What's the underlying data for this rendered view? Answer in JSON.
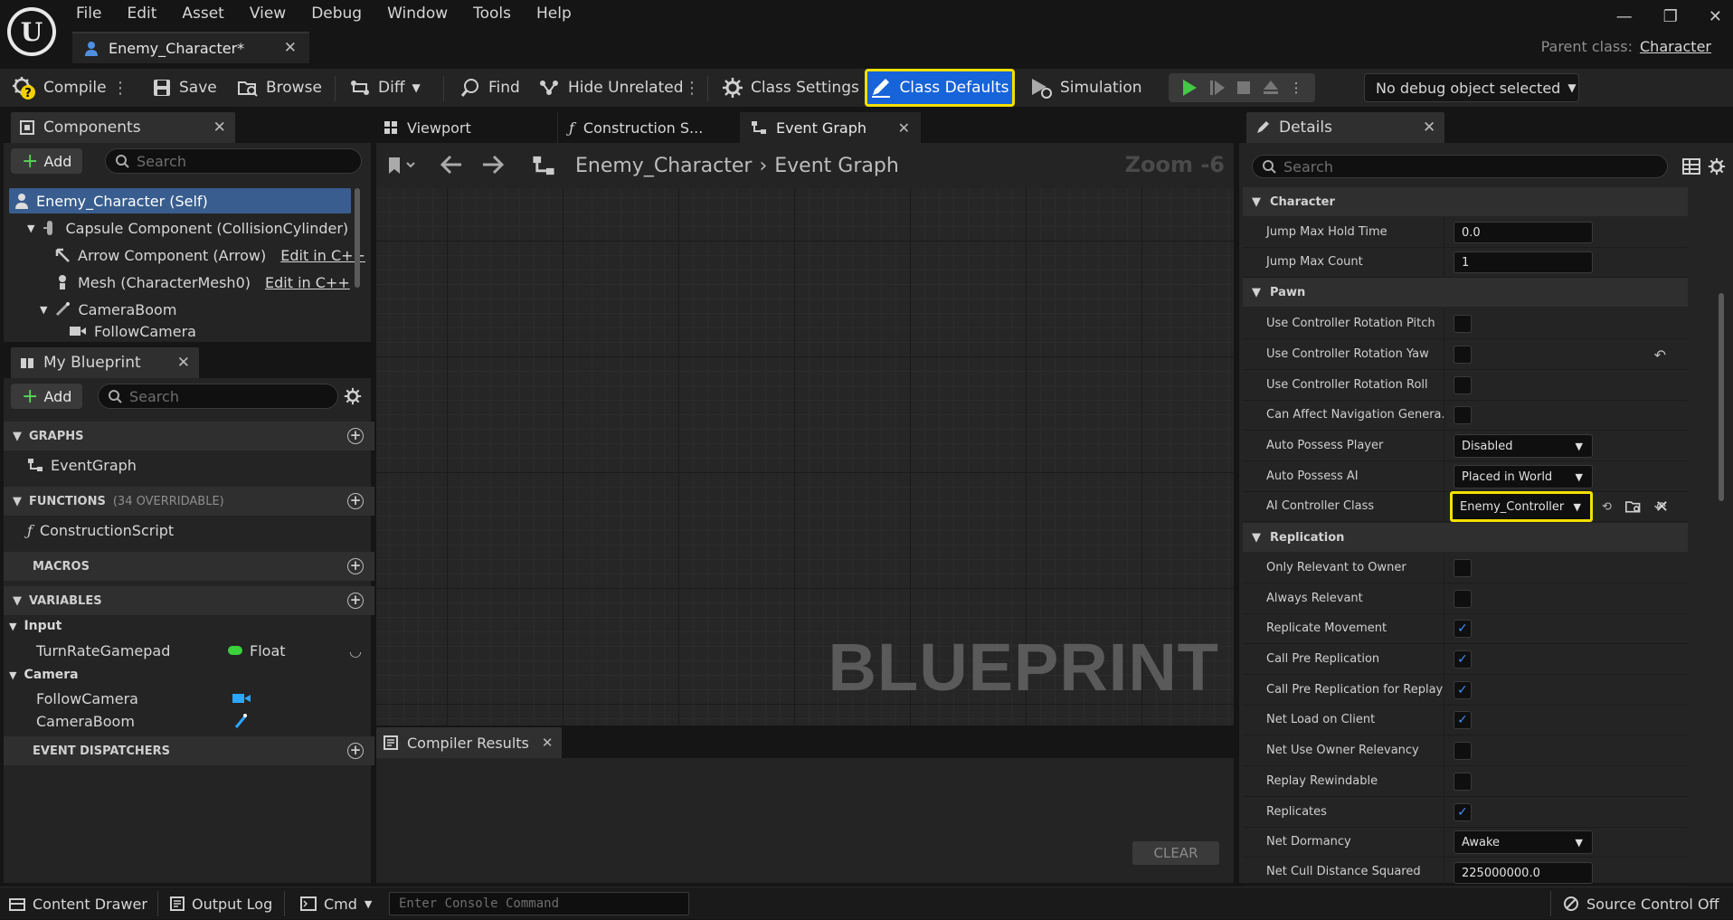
{
  "app": {
    "logo": "U",
    "tab_title": "Enemy_Character*",
    "parent_label": "Parent class:",
    "parent_value": "Character"
  },
  "menu": [
    "File",
    "Edit",
    "Asset",
    "View",
    "Debug",
    "Window",
    "Tools",
    "Help"
  ],
  "toolbar": {
    "compile": "Compile",
    "save": "Save",
    "browse": "Browse",
    "diff": "Diff",
    "find": "Find",
    "hide_unrelated": "Hide Unrelated",
    "class_settings": "Class Settings",
    "class_defaults": "Class Defaults",
    "simulation": "Simulation",
    "debug_select": "No debug object selected"
  },
  "components": {
    "title": "Components",
    "add": "Add",
    "search_placeholder": "Search",
    "items": [
      {
        "label": "Enemy_Character (Self)"
      },
      {
        "label": "Capsule Component (CollisionCylinder)"
      },
      {
        "label": "Arrow Component (Arrow)",
        "edit": "Edit in C++"
      },
      {
        "label": "Mesh (CharacterMesh0)",
        "edit": "Edit in C++"
      },
      {
        "label": "CameraBoom"
      },
      {
        "label": "FollowCamera"
      }
    ]
  },
  "my_blueprint": {
    "title": "My Blueprint",
    "add": "Add",
    "search_placeholder": "Search",
    "graphs": "GRAPHS",
    "event_graph": "EventGraph",
    "functions": "FUNCTIONS",
    "functions_sub": "(34 OVERRIDABLE)",
    "construction_script": "ConstructionScript",
    "macros": "MACROS",
    "variables": "VARIABLES",
    "cat_input": "Input",
    "var_turn": "TurnRateGamepad",
    "var_turn_type": "Float",
    "cat_camera": "Camera",
    "var_follow": "FollowCamera",
    "var_boom": "CameraBoom",
    "dispatchers": "EVENT DISPATCHERS"
  },
  "center": {
    "tab_viewport": "Viewport",
    "tab_construction": "Construction S...",
    "tab_event": "Event Graph",
    "crumb_root": "Enemy_Character",
    "crumb_leaf": "Event Graph",
    "zoom": "Zoom -6",
    "watermark": "BLUEPRINT",
    "compiler_tab": "Compiler Results",
    "clear": "CLEAR"
  },
  "details": {
    "title": "Details",
    "search_placeholder": "Search",
    "sec_character": "Character",
    "jump_hold_label": "Jump Max Hold Time",
    "jump_hold_val": "0.0",
    "jump_count_label": "Jump Max Count",
    "jump_count_val": "1",
    "sec_pawn": "Pawn",
    "ucr_pitch": "Use Controller Rotation Pitch",
    "ucr_yaw": "Use Controller Rotation Yaw",
    "ucr_roll": "Use Controller Rotation Roll",
    "can_nav": "Can Affect Navigation Genera...",
    "auto_player_label": "Auto Possess Player",
    "auto_player_val": "Disabled",
    "auto_ai_label": "Auto Possess AI",
    "auto_ai_val": "Placed in World",
    "ai_class_label": "AI Controller Class",
    "ai_class_val": "Enemy_Controller",
    "sec_replication": "Replication",
    "only_relevant": "Only Relevant to Owner",
    "always_relevant": "Always Relevant",
    "rep_movement": "Replicate Movement",
    "call_pre": "Call Pre Replication",
    "call_pre_replay": "Call Pre Replication for Replay",
    "net_load": "Net Load on Client",
    "net_owner": "Net Use Owner Relevancy",
    "replay_rew": "Replay Rewindable",
    "replicates": "Replicates",
    "net_dormancy_label": "Net Dormancy",
    "net_dormancy_val": "Awake",
    "net_cull_label": "Net Cull Distance Squared",
    "net_cull_val": "225000000.0"
  },
  "status": {
    "content_drawer": "Content Drawer",
    "output_log": "Output Log",
    "cmd": "Cmd",
    "console_placeholder": "Enter Console Command",
    "source_control": "Source Control Off"
  },
  "colors": {
    "accent": "#1763d9",
    "highlight": "#f4e000",
    "float_pin": "#3ad13a",
    "camera_icon": "#2aa7ff",
    "check": "#3f8fff"
  }
}
